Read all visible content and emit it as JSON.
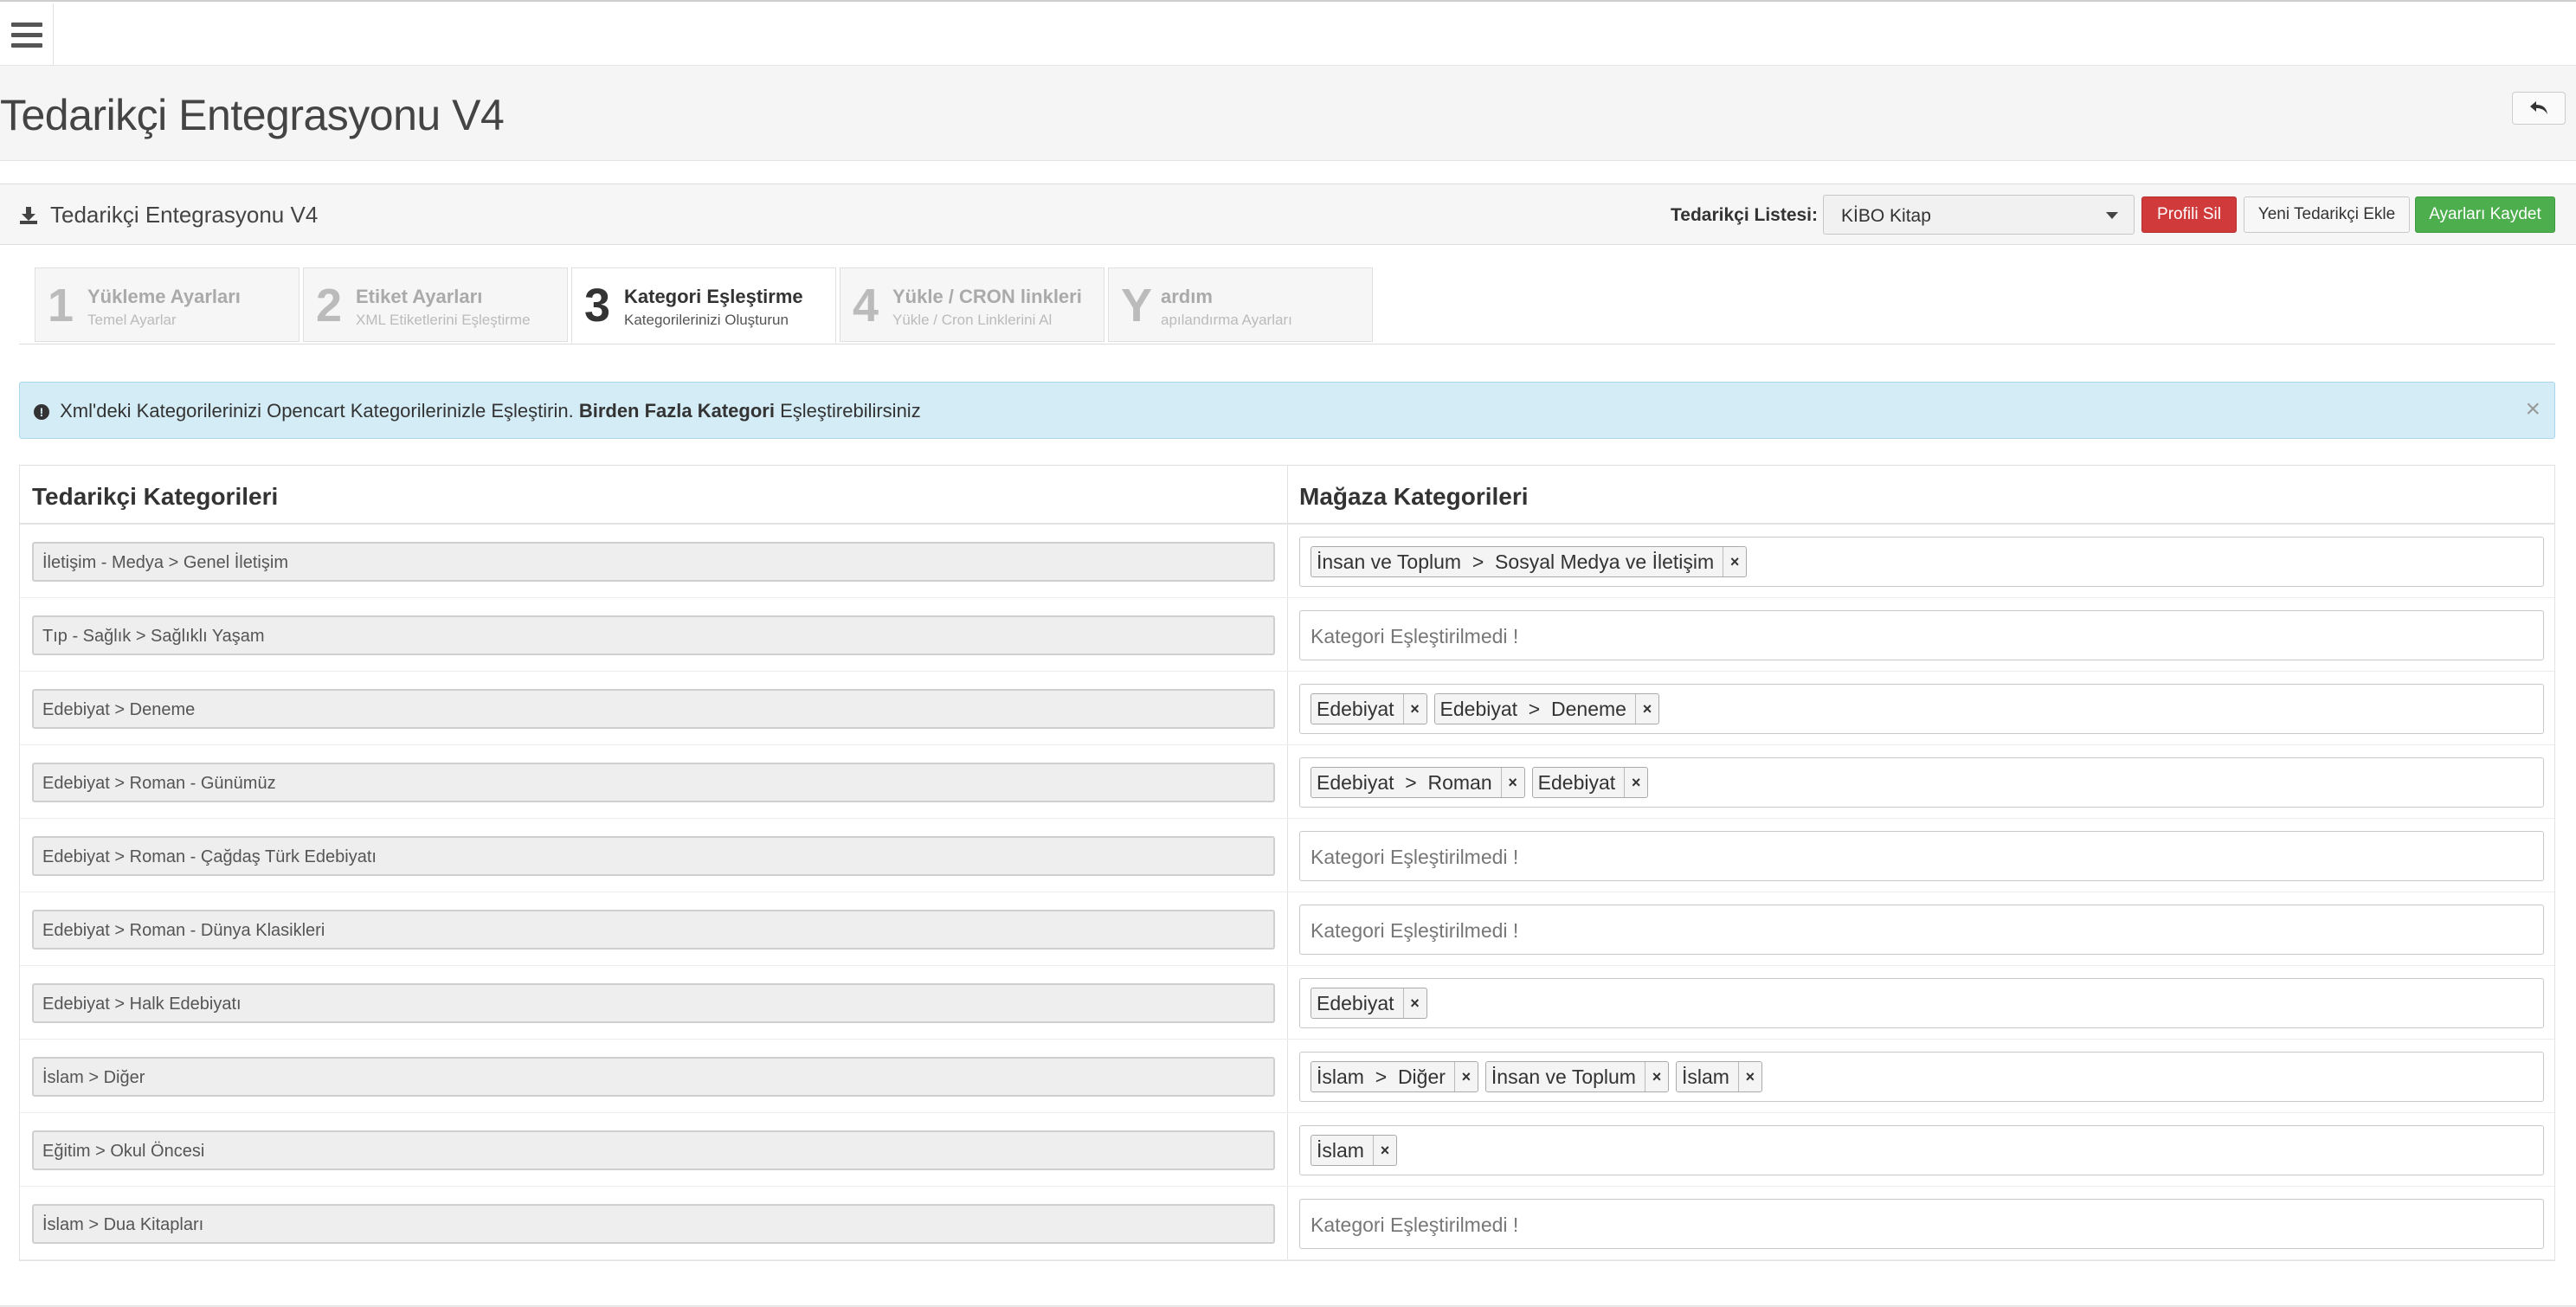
{
  "header": {
    "page_title": "Tedarikçi Entegrasyonu V4"
  },
  "panel": {
    "title": "Tedarikçi Entegrasyonu V4",
    "supplier_label": "Tedarikçi Listesi:",
    "supplier_selected": "KİBO Kitap",
    "btn_delete": "Profili Sil",
    "btn_new": "Yeni Tedarikçi Ekle",
    "btn_save": "Ayarları Kaydet"
  },
  "steps": [
    {
      "num": "1",
      "title": "Yükleme Ayarları",
      "sub": "Temel Ayarlar",
      "active": false
    },
    {
      "num": "2",
      "title": "Etiket Ayarları",
      "sub": "XML Etiketlerini Eşleştirme",
      "active": false
    },
    {
      "num": "3",
      "title": "Kategori Eşleştirme",
      "sub": "Kategorilerinizi Oluşturun",
      "active": true
    },
    {
      "num": "4",
      "title": "Yükle / CRON linkleri",
      "sub": "Yükle / Cron Linklerini Al",
      "active": false
    },
    {
      "num": "Y",
      "title": "ardım",
      "sub": "apılandırma Ayarları",
      "active": false
    }
  ],
  "alert": {
    "text_before": "Xml'deki Kategorilerinizi Opencart Kategorilerinizle Eşleştirin.",
    "text_bold": "Birden Fazla Kategori",
    "text_after": "Eşleştirebilirsiniz",
    "close": "×"
  },
  "table": {
    "col_left": "Tedarikçi Kategorileri",
    "col_right": "Mağaza Kategorileri",
    "placeholder": "Kategori Eşleştirilmedi !",
    "rows": [
      {
        "source": "İletişim - Medya > Genel İletişim",
        "tags": [
          "İnsan ve Toplum  >  Sosyal Medya ve İletişim"
        ]
      },
      {
        "source": "Tıp - Sağlık > Sağlıklı Yaşam",
        "tags": []
      },
      {
        "source": "Edebiyat > Deneme",
        "tags": [
          "Edebiyat",
          "Edebiyat  >  Deneme"
        ]
      },
      {
        "source": "Edebiyat > Roman - Günümüz",
        "tags": [
          "Edebiyat  >  Roman",
          "Edebiyat"
        ]
      },
      {
        "source": "Edebiyat > Roman - Çağdaş Türk Edebiyatı",
        "tags": []
      },
      {
        "source": "Edebiyat > Roman - Dünya Klasikleri",
        "tags": []
      },
      {
        "source": "Edebiyat > Halk Edebiyatı",
        "tags": [
          "Edebiyat"
        ]
      },
      {
        "source": "İslam > Diğer",
        "tags": [
          "İslam  >  Diğer",
          "İnsan ve Toplum",
          "İslam"
        ]
      },
      {
        "source": "Eğitim > Okul Öncesi",
        "tags": [
          "İslam"
        ]
      },
      {
        "source": "İslam > Dua Kitapları",
        "tags": []
      }
    ]
  }
}
